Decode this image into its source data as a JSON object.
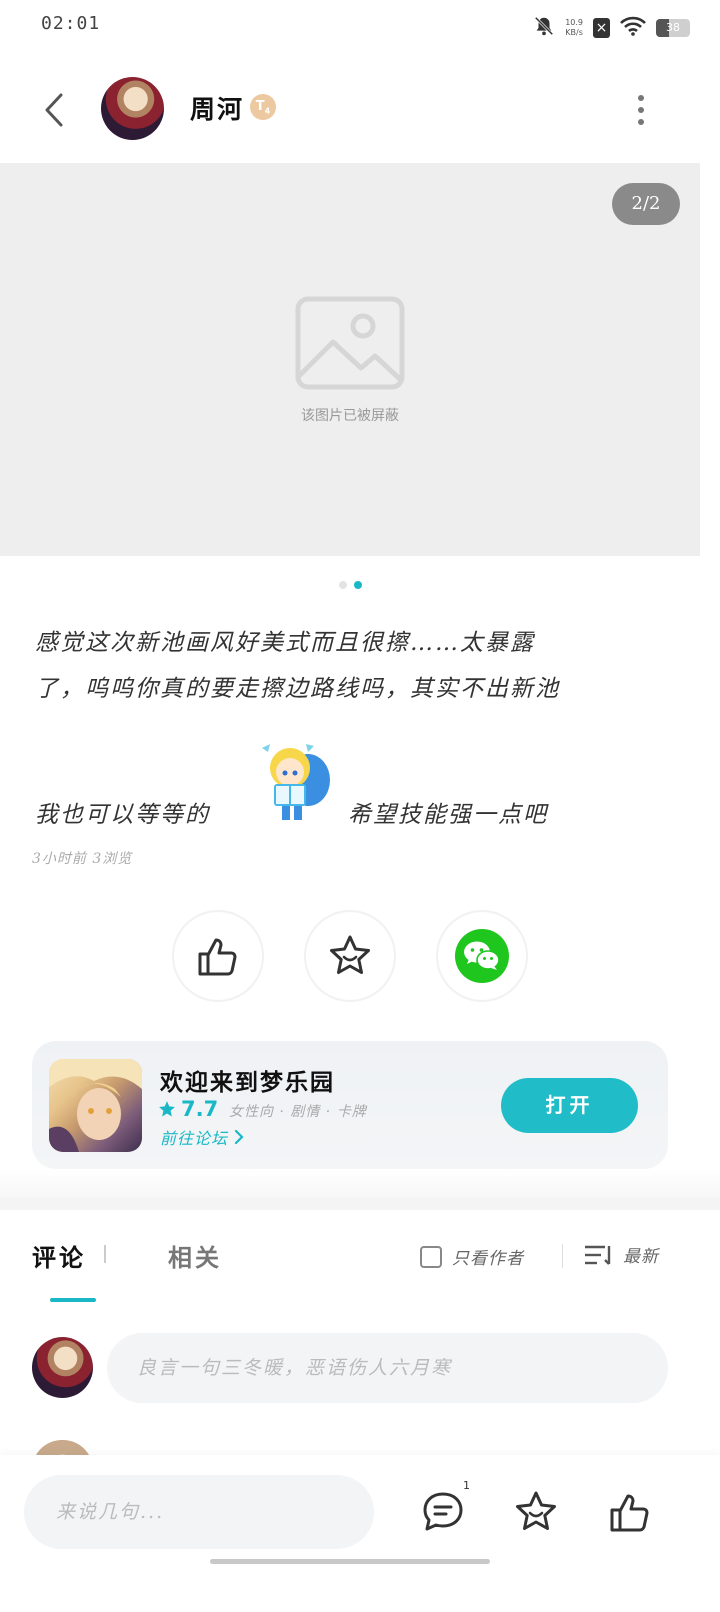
{
  "status_bar": {
    "time": "02:01",
    "net_speed_value": "10.9",
    "net_speed_unit": "KB/s",
    "battery_level": "38",
    "battery_fraction": 0.38
  },
  "header": {
    "author_name": "周河",
    "level_badge": "T",
    "level_num": "4"
  },
  "image": {
    "page_counter": "2/2",
    "blocked_text": "该图片已被屏蔽"
  },
  "post": {
    "line1": "感觉这次新池画风好美式而且很擦……太暴露",
    "line2": "了，呜呜你真的要走擦边路线吗，其实不出新池",
    "line3a": "我也可以等等的",
    "line3b": "希望技能强一点吧",
    "meta": "3小时前 3浏览"
  },
  "actions": {
    "like_icon": "thumbs-up-icon",
    "favorite_icon": "star-icon",
    "share_icon": "wechat-icon"
  },
  "game": {
    "name": "欢迎来到梦乐园",
    "rating": "7.7",
    "tags": "女性向 · 剧情 · 卡牌",
    "forum_link": "前往论坛",
    "open_label": "打开"
  },
  "tabs": {
    "comments": "评论",
    "related": "相关",
    "author_only": "只看作者",
    "sort": "最新"
  },
  "comment_input": {
    "placeholder": "良言一句三冬暖，恶语伤人六月寒"
  },
  "bottom_bar": {
    "placeholder": "来说几句...",
    "comment_count": "1"
  },
  "colors": {
    "accent": "#1ab8c6",
    "open_button": "#20bdc8",
    "wechat_green": "#1ec61e"
  }
}
